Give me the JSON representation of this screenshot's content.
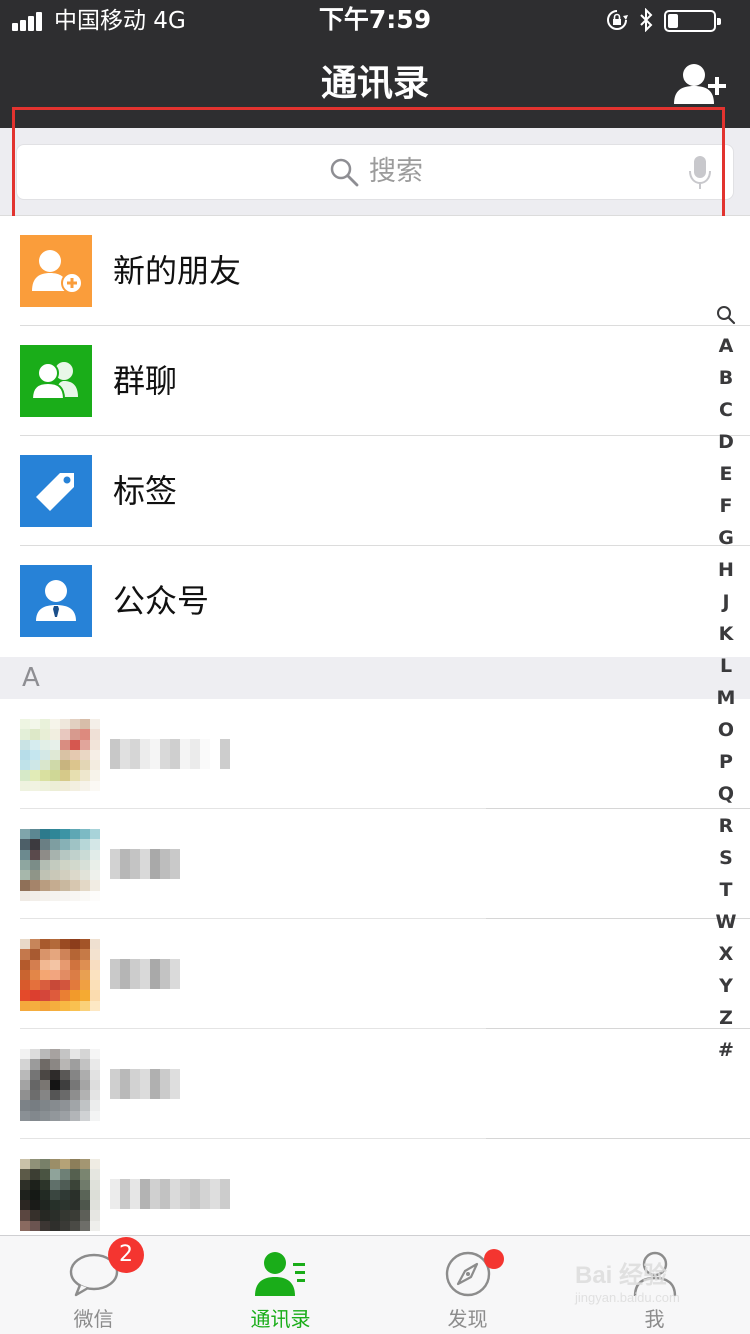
{
  "status_bar": {
    "carrier": "中国移动  4G",
    "time": "下午7:59"
  },
  "nav": {
    "title": "通讯录"
  },
  "search": {
    "placeholder": "搜索"
  },
  "functions": [
    {
      "label": "新的朋友",
      "icon": "new-friend-icon",
      "color": "#fa9d3b"
    },
    {
      "label": "群聊",
      "icon": "group-chat-icon",
      "color": "#1aad19"
    },
    {
      "label": "标签",
      "icon": "tag-icon",
      "color": "#2782d7"
    },
    {
      "label": "公众号",
      "icon": "official-account-icon",
      "color": "#2782d7"
    }
  ],
  "contacts": {
    "section_letter": "A"
  },
  "index_bar": {
    "letters": [
      "A",
      "B",
      "C",
      "D",
      "E",
      "F",
      "G",
      "H",
      "J",
      "K",
      "L",
      "M",
      "O",
      "P",
      "Q",
      "R",
      "S",
      "T",
      "W",
      "X",
      "Y",
      "Z",
      "#"
    ]
  },
  "tabs": [
    {
      "label": "微信",
      "icon": "chat-bubble-icon",
      "badge": "2"
    },
    {
      "label": "通讯录",
      "icon": "contacts-icon",
      "active": true
    },
    {
      "label": "发现",
      "icon": "compass-icon",
      "dot": true
    },
    {
      "label": "我",
      "icon": "me-icon"
    }
  ],
  "watermark": {
    "main": "Bai 经验",
    "sub": "jingyan.baidu.com"
  },
  "colors": {
    "header_bg": "#2e2e30",
    "accent_green": "#1aad19",
    "badge_red": "#f43530",
    "highlight_red": "#e2332f"
  }
}
